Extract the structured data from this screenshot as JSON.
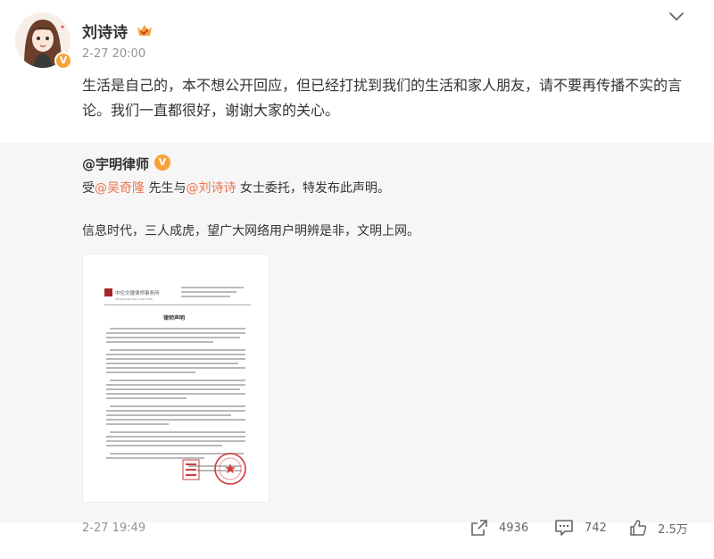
{
  "post": {
    "author": "刘诗诗",
    "verified_badge": "V",
    "time": "2-27 20:00",
    "text": "生活是自己的，本不想公开回应，但已经打扰到我们的生活和家人朋友，请不要再传播不实的言论。我们一直都很好，谢谢大家的关心。"
  },
  "repost": {
    "author": "@宇明律师",
    "verified_badge": "V",
    "line1_prefix": "受",
    "mention1": "@吴奇隆",
    "line1_mid": " 先生与",
    "mention2": "@刘诗诗",
    "line1_suffix": " 女士委托，特发布此声明。",
    "line2": "信息时代，三人成虎，望广大网络用户明辨是非，文明上网。",
    "document": {
      "firm_name": "中伦文德律师事务所",
      "firm_name_en": "ZHONGLUN W&D LAW FIRM",
      "title": "律师声明"
    }
  },
  "footer": {
    "time": "2-27 19:49",
    "repost_count": "4936",
    "comment_count": "742",
    "like_count": "2.5万"
  },
  "colors": {
    "mention": "#eb7350",
    "badge_gold": "#f7a23b",
    "repost_bg": "#f6f6f6",
    "meta_gray": "#939393"
  },
  "icons": [
    "chevron-down-icon",
    "member-crown-icon",
    "repost-icon",
    "comment-icon",
    "like-icon"
  ]
}
